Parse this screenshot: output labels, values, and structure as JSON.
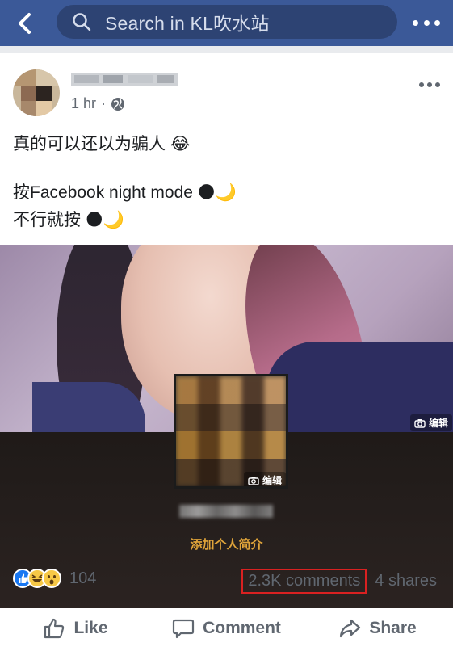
{
  "topbar": {
    "search_placeholder": "Search in KL吹水站",
    "back_icon": "chevron-left-icon",
    "more_icon": "more-horizontal-icon",
    "bg_color": "#3b5998"
  },
  "post": {
    "time": "1 hr",
    "separator": "·",
    "privacy_icon": "globe-icon",
    "lines": [
      "真的可以还以为骗人 😂",
      "按Facebook night mode 🌑🌙",
      "不行就按 🌑🌙"
    ],
    "photo": {
      "edit_label": "编辑",
      "edit_label_inset": "编辑",
      "profile_link": "添加个人简介"
    }
  },
  "reactions": {
    "count": "104",
    "types": [
      "like",
      "haha",
      "wow"
    ]
  },
  "counts": {
    "comments": "2.3K comments",
    "shares": "4 shares",
    "highlight_color": "#d92121"
  },
  "actions": {
    "like": "Like",
    "comment": "Comment",
    "share": "Share"
  }
}
